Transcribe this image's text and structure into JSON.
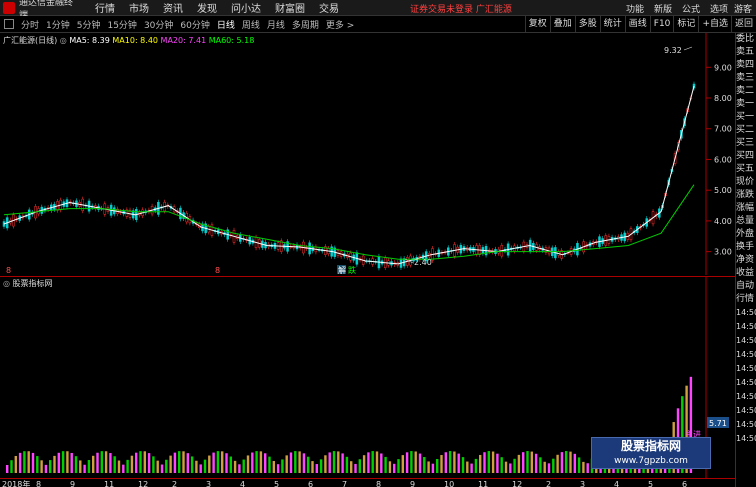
{
  "menubar": {
    "app_title": "通达信金融终端",
    "menu": [
      "行情",
      "市场",
      "资讯",
      "发现",
      "问小达",
      "财富圈",
      "交易"
    ],
    "notice": "证券交易未登录  广汇能源",
    "right_items": [
      "功能",
      "新版",
      "公式",
      "选项"
    ],
    "guest": "游客"
  },
  "toolbar": {
    "periods": [
      "分时",
      "1分钟",
      "5分钟",
      "15分钟",
      "30分钟",
      "60分钟",
      "日线",
      "周线",
      "月线",
      "多周期",
      "更多 >"
    ],
    "active_period": "日线",
    "tools": [
      "复权",
      "叠加",
      "多股",
      "统计",
      "画线",
      "F10",
      "标记",
      "+自选",
      "返回"
    ]
  },
  "main_chart": {
    "title": "广汇能源(日线)",
    "ma": [
      {
        "label": "MA5: 8.39",
        "color": "#ffffff"
      },
      {
        "label": "MA10: 8.40",
        "color": "#ffff00"
      },
      {
        "label": "MA20: 7.41",
        "color": "#ff44ff"
      },
      {
        "label": "MA60: 5.18",
        "color": "#00ff00"
      }
    ],
    "y_ticks": [
      "9.00",
      "8.00",
      "7.00",
      "6.00",
      "5.00",
      "4.00",
      "3.00"
    ],
    "high_label": "9.32",
    "low_label": "2.40",
    "markers": [
      "解",
      "跌"
    ],
    "small_markers": [
      "8",
      "8"
    ]
  },
  "chart_data": {
    "type": "line",
    "title": "广汇能源(日线)",
    "xlabel": "",
    "ylabel": "",
    "ylim": [
      2.5,
      9.4
    ],
    "series": [
      {
        "name": "MA5",
        "values": [
          3.9,
          4.3,
          4.6,
          4.4,
          4.2,
          4.5,
          3.8,
          3.5,
          3.2,
          3.15,
          3.0,
          2.7,
          2.6,
          2.9,
          3.1,
          3.0,
          3.2,
          2.9,
          3.3,
          3.5,
          4.3,
          8.39
        ]
      },
      {
        "name": "MA60",
        "values": [
          4.2,
          4.3,
          4.4,
          4.4,
          4.3,
          4.3,
          3.9,
          3.6,
          3.4,
          3.2,
          3.1,
          2.9,
          2.75,
          2.75,
          2.85,
          3.0,
          3.0,
          3.0,
          3.1,
          3.2,
          3.6,
          5.18
        ]
      }
    ],
    "annotations": [
      "9.32",
      "2.40"
    ]
  },
  "sub_chart": {
    "title": "股票指标网",
    "value_label": "5.71",
    "label": "主进"
  },
  "x_axis": [
    "2018年",
    "8",
    "9",
    "11",
    "12",
    "2",
    "3",
    "4",
    "5",
    "6",
    "7",
    "8",
    "9",
    "10",
    "11",
    "12",
    "2",
    "3",
    "4",
    "5",
    "6"
  ],
  "right_panel": {
    "labels": [
      "委比",
      "卖五",
      "卖四",
      "卖三",
      "卖二",
      "卖一",
      "买一",
      "买二",
      "买三",
      "买四",
      "买五",
      "现价",
      "涨跌",
      "涨幅",
      "总量",
      "外盘",
      "换手",
      "净资",
      "收益"
    ],
    "labels2": [
      "自动",
      "行情"
    ],
    "times": [
      "14:50",
      "14:50",
      "14:50",
      "14:50",
      "14:50",
      "14:50",
      "14:50",
      "14:50",
      "14:50",
      "14:50"
    ]
  },
  "watermark": {
    "line1": "股票指标网",
    "line2": "www.7gpzb.com"
  }
}
